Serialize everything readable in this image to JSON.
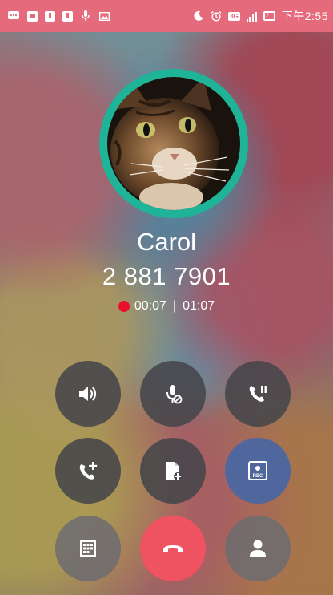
{
  "status_bar": {
    "network_type": "3G",
    "time": "下午2:55"
  },
  "call": {
    "caller_name": "Carol",
    "phone_number": "2 881 7901",
    "recording_time": "00:07",
    "call_duration": "01:07",
    "separator": "|"
  },
  "buttons": {
    "row1": [
      "speaker-icon",
      "mute-mic-icon",
      "hold-call-icon"
    ],
    "row2": [
      "add-call-icon",
      "add-note-icon",
      "record-icon"
    ],
    "row3": [
      "dialpad-icon",
      "end-call-icon",
      "contact-icon"
    ],
    "record_label": "REC"
  },
  "colors": {
    "status_bar": "#e46a7c",
    "avatar_ring": "#1fb497",
    "record_button": "#4f679d",
    "end_call_button": "#ef5260",
    "record_dot": "#e8102a"
  }
}
